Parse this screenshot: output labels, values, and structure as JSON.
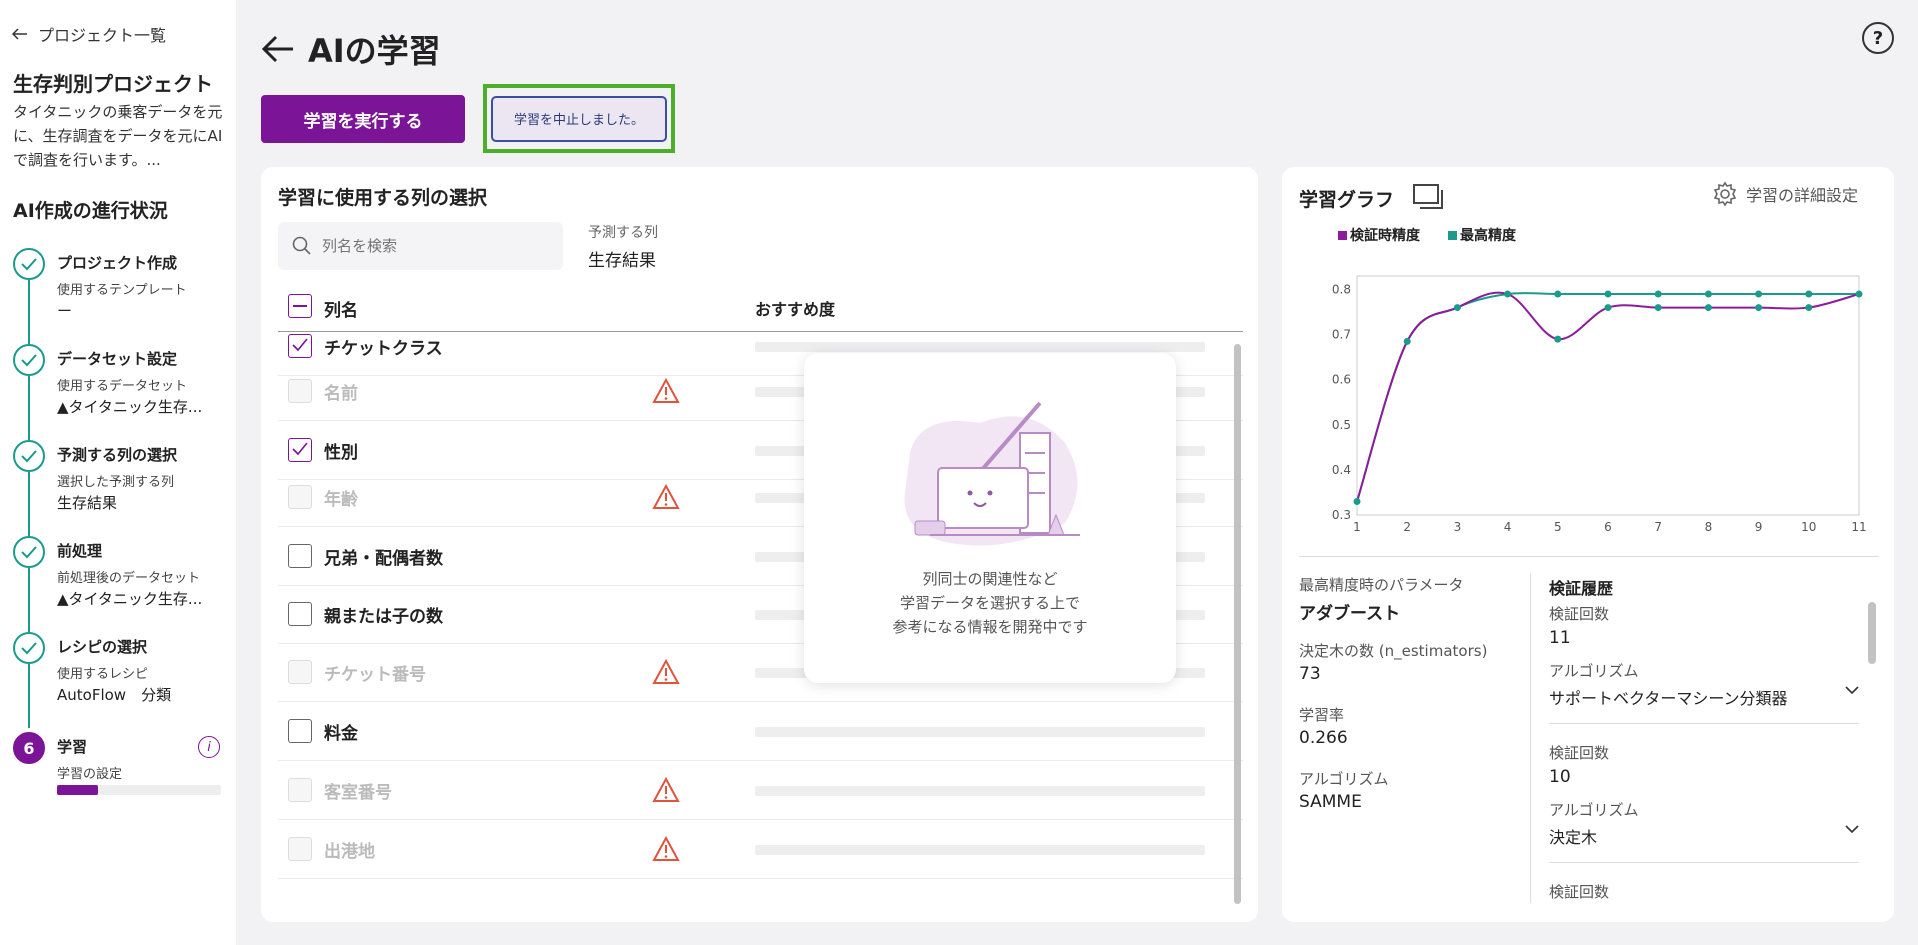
{
  "sidebar": {
    "back_label": "プロジェクト一覧",
    "project_title": "生存判別プロジェクト",
    "project_desc": "タイタニックの乗客データを元に、生存調査をデータを元にAIで調査を行います。...",
    "progress_title": "AI作成の進行状況",
    "steps": [
      {
        "label": "プロジェクト作成",
        "sub": "使用するテンプレート",
        "value": "ー",
        "status": "done"
      },
      {
        "label": "データセット設定",
        "sub": "使用するデータセット",
        "value": "▲タイタニック生存...",
        "status": "done"
      },
      {
        "label": "予測する列の選択",
        "sub": "選択した予測する列",
        "value": "生存結果",
        "status": "done"
      },
      {
        "label": "前処理",
        "sub": "前処理後のデータセット",
        "value": "▲タイタニック生存...",
        "status": "done"
      },
      {
        "label": "レシピの選択",
        "sub": "使用するレシピ",
        "value": "AutoFlow　分類",
        "status": "done"
      },
      {
        "label": "学習",
        "sub": "学習の設定",
        "number": "6",
        "status": "active",
        "progress": 0.25
      }
    ]
  },
  "header": {
    "title": "AIの学習",
    "run_button": "学習を実行する",
    "stop_button": "学習を中止しました。"
  },
  "columns_panel": {
    "title": "学習に使用する列の選択",
    "search_placeholder": "列名を検索",
    "predict_label": "予測する列",
    "predict_value": "生存結果",
    "header_name": "列名",
    "header_reco": "おすすめ度",
    "rows": [
      {
        "name": "チケットクラス",
        "checked": true,
        "disabled": false,
        "warning": false
      },
      {
        "name": "名前",
        "checked": false,
        "disabled": true,
        "warning": true
      },
      {
        "name": "性別",
        "checked": true,
        "disabled": false,
        "warning": false
      },
      {
        "name": "年齢",
        "checked": false,
        "disabled": true,
        "warning": true
      },
      {
        "name": "兄弟・配偶者数",
        "checked": false,
        "disabled": false,
        "warning": false
      },
      {
        "name": "親または子の数",
        "checked": false,
        "disabled": false,
        "warning": false
      },
      {
        "name": "チケット番号",
        "checked": false,
        "disabled": true,
        "warning": true
      },
      {
        "name": "料金",
        "checked": false,
        "disabled": false,
        "warning": false
      },
      {
        "name": "客室番号",
        "checked": false,
        "disabled": true,
        "warning": true
      },
      {
        "name": "出港地",
        "checked": false,
        "disabled": true,
        "warning": true
      }
    ],
    "overlay_lines": [
      "列同士の関連性など",
      "学習データを選択する上で",
      "参考になる情報を開発中です"
    ]
  },
  "graph_panel": {
    "title": "学習グラフ",
    "detail_settings": "学習の詳細設定",
    "best_params_label": "最高精度時のパラメータ",
    "best_params_value": "アダブースト",
    "params": [
      {
        "label": "決定木の数 (n_estimators)",
        "value": "73"
      },
      {
        "label": "学習率",
        "value": "0.266"
      },
      {
        "label": "アルゴリズム",
        "value": "SAMME"
      }
    ],
    "history_title": "検証履歴",
    "history": [
      {
        "count_label": "検証回数",
        "count": "11",
        "algo_label": "アルゴリズム",
        "algo": "サポートベクターマシーン分類器"
      },
      {
        "count_label": "検証回数",
        "count": "10",
        "algo_label": "アルゴリズム",
        "algo": "決定木"
      },
      {
        "count_label": "検証回数",
        "count": "",
        "algo_label": "",
        "algo": ""
      }
    ]
  },
  "chart_data": {
    "type": "line",
    "x": [
      1,
      2,
      3,
      4,
      5,
      6,
      7,
      8,
      9,
      10,
      11
    ],
    "series": [
      {
        "name": "検証時精度",
        "color": "#8e1a9c",
        "values": [
          0.33,
          0.685,
          0.76,
          0.79,
          0.69,
          0.76,
          0.76,
          0.76,
          0.76,
          0.76,
          0.79
        ]
      },
      {
        "name": "最高精度",
        "color": "#1a9b8c",
        "values": [
          0.33,
          0.685,
          0.76,
          0.79,
          0.79,
          0.79,
          0.79,
          0.79,
          0.79,
          0.79,
          0.79
        ]
      }
    ],
    "xticks": [
      1,
      2,
      3,
      4,
      5,
      6,
      7,
      8,
      9,
      10,
      11
    ],
    "yticks": [
      0.3,
      0.4,
      0.5,
      0.6,
      0.7,
      0.8
    ],
    "xlim": [
      1,
      11
    ],
    "ylim": [
      0.3,
      0.83
    ],
    "legend": "top-left",
    "grid": false
  }
}
